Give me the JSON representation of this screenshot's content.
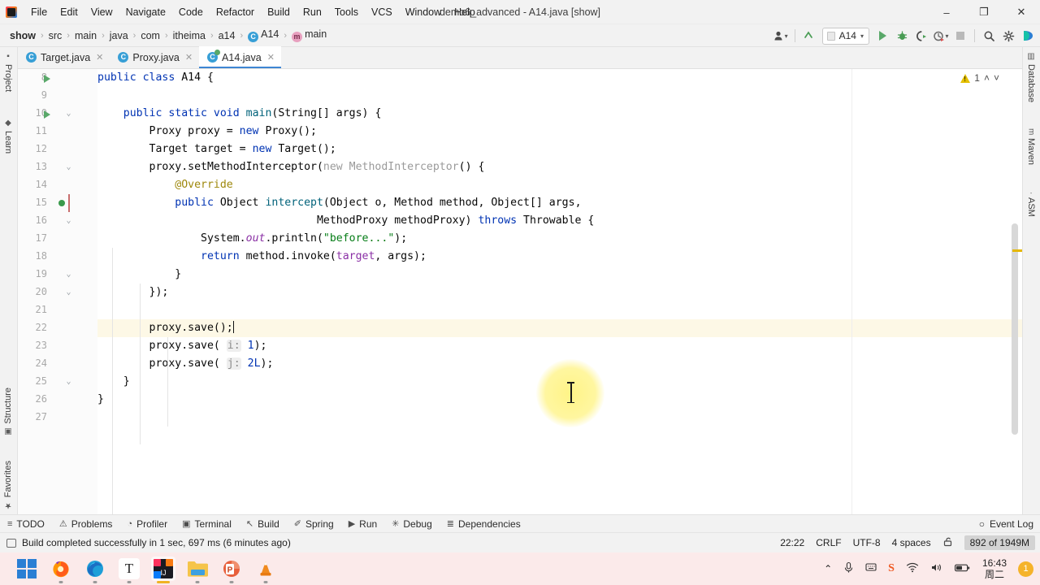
{
  "window": {
    "title": "demo6_advanced  -  A14.java [show]",
    "minimize": "–",
    "maximize": "❐",
    "close": "✕"
  },
  "menu": [
    "File",
    "Edit",
    "View",
    "Navigate",
    "Code",
    "Refactor",
    "Build",
    "Run",
    "Tools",
    "VCS",
    "Window",
    "Help"
  ],
  "breadcrumb": {
    "items": [
      "show",
      "src",
      "main",
      "java",
      "com",
      "itheima",
      "a14",
      "A14",
      "main"
    ],
    "separator": "›",
    "class_icon_letter": "C",
    "method_icon_letter": "m"
  },
  "toolbar": {
    "profile_icon": "user-profile-icon",
    "updates_icon": "update-arrow-icon",
    "run_config": "A14",
    "run_label": "run-button",
    "debug_label": "debug-button",
    "coverage_label": "run-with-coverage-button",
    "profile_label": "profiler-button",
    "stop_label": "stop-button",
    "search_label": "search-everywhere",
    "settings_label": "settings-button",
    "ide_label": "ide-helper"
  },
  "tabs": [
    {
      "label": "Target.java",
      "active": false
    },
    {
      "label": "Proxy.java",
      "active": false
    },
    {
      "label": "A14.java",
      "active": true
    }
  ],
  "left_strip": [
    {
      "label": "Project",
      "icon": "■"
    },
    {
      "label": "Learn",
      "icon": "◆"
    },
    {
      "label": "Structure",
      "icon": "▣"
    },
    {
      "label": "Favorites",
      "icon": "★"
    }
  ],
  "right_strip": [
    {
      "label": "Database",
      "icon": "▥"
    },
    {
      "label": "Maven",
      "icon": "m"
    },
    {
      "label": "ASM",
      "icon": "·"
    }
  ],
  "editor": {
    "inspection_count": "1",
    "up_arrow": "˄",
    "down_arrow": "˅",
    "first_line_number": 8,
    "lines": [
      {
        "n": 8,
        "html": "<span class=\"k\">public class</span> A14 {"
      },
      {
        "n": 9,
        "html": ""
      },
      {
        "n": 10,
        "html": "    <span class=\"k\">public static void</span> <span class=\"mc\">main</span>(String[] args) {"
      },
      {
        "n": 11,
        "html": "        Proxy proxy = <span class=\"k\">new</span> Proxy();"
      },
      {
        "n": 12,
        "html": "        Target target = <span class=\"k\">new</span> Target();"
      },
      {
        "n": 13,
        "html": "        proxy.setMethodInterceptor(<span class=\"gy\">new MethodInterceptor</span>() {"
      },
      {
        "n": 14,
        "html": "            <span class=\"an\">@Override</span>"
      },
      {
        "n": 15,
        "html": "            <span class=\"k\">public</span> Object <span class=\"mc\">intercept</span>(Object o, Method method, Object[] args,"
      },
      {
        "n": 16,
        "html": "                                  MethodProxy methodProxy) <span class=\"k\">throws</span> Throwable {"
      },
      {
        "n": 17,
        "html": "                System.<span class=\"it\">out</span>.println(<span class=\"cn\">\"before...\"</span>);"
      },
      {
        "n": 18,
        "html": "                <span class=\"k\">return</span> method.invoke(<span class=\"hp\">target</span>, args);"
      },
      {
        "n": 19,
        "html": "            }"
      },
      {
        "n": 20,
        "html": "        });"
      },
      {
        "n": 21,
        "html": ""
      },
      {
        "n": 22,
        "html": "        proxy.save();<span class=\"caret\"></span>"
      },
      {
        "n": 23,
        "html": "        proxy.save( <span class=\"pill\">i:</span> <span class=\"k\">1</span>);"
      },
      {
        "n": 24,
        "html": "        proxy.save( <span class=\"pill\">j:</span> <span class=\"k\">2L</span>);"
      },
      {
        "n": 25,
        "html": "    }"
      },
      {
        "n": 26,
        "html": "}"
      },
      {
        "n": 27,
        "html": ""
      }
    ],
    "current_line": 22,
    "run_markers": [
      8,
      10
    ],
    "fold_markers": [
      10,
      13,
      16,
      19,
      20,
      25
    ],
    "breakpoint_line": 15
  },
  "bottom_tools": [
    {
      "label": "TODO",
      "icon": "≡"
    },
    {
      "label": "Problems",
      "icon": "⚠"
    },
    {
      "label": "Profiler",
      "icon": "◔"
    },
    {
      "label": "Terminal",
      "icon": "▣"
    },
    {
      "label": "Build",
      "icon": "↖"
    },
    {
      "label": "Spring",
      "icon": "✐"
    },
    {
      "label": "Run",
      "icon": "▶"
    },
    {
      "label": "Debug",
      "icon": "✳"
    },
    {
      "label": "Dependencies",
      "icon": "≣"
    }
  ],
  "event_log": {
    "label": "Event Log",
    "icon": "○"
  },
  "status": {
    "message": "Build completed successfully in 1 sec, 697 ms (6 minutes ago)",
    "caret_position": "22:22",
    "line_separator": "CRLF",
    "encoding": "UTF-8",
    "indent": "4 spaces",
    "lock_icon": "⚿",
    "memory": "892 of 1949M"
  },
  "taskbar": {
    "apps": [
      {
        "name": "start-button",
        "glyph": ""
      },
      {
        "name": "firefox",
        "glyph": ""
      },
      {
        "name": "edge",
        "glyph": ""
      },
      {
        "name": "typora",
        "glyph": "T"
      },
      {
        "name": "intellij-idea",
        "glyph": "IJ"
      },
      {
        "name": "file-explorer",
        "glyph": ""
      },
      {
        "name": "powerpoint",
        "glyph": "P"
      },
      {
        "name": "vlc",
        "glyph": ""
      }
    ],
    "tray": {
      "chevron": "⌃",
      "mic": "ƨ",
      "ime": "输",
      "sogou": "S",
      "wifi": "◠",
      "volume": "ᴘ",
      "battery": "▭"
    },
    "time": "16:43",
    "date": "周二",
    "badge": "1"
  },
  "colors": {
    "accent": "#3e86d3",
    "run_green": "#59a869",
    "warn_yellow": "#e5c000",
    "chrome": "#f2f2f2",
    "editor_bg": "#ffffff",
    "taskbar": "#fbeaea"
  }
}
